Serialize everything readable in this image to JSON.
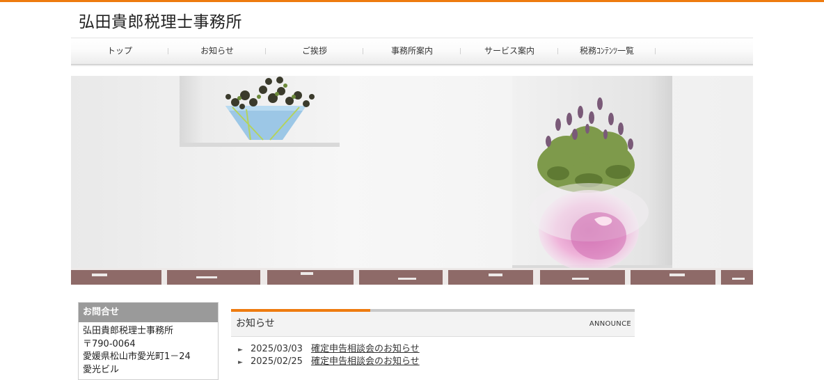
{
  "site": {
    "title": "弘田貴郎税理士事務所"
  },
  "colors": {
    "accent": "#ee7b0f",
    "nav_text": "#333333",
    "sidebar_head": "#9a9a9a"
  },
  "nav": {
    "items": [
      {
        "label": "トップ"
      },
      {
        "label": "お知らせ"
      },
      {
        "label": "ご挨拶"
      },
      {
        "label": "事務所案内"
      },
      {
        "label": "サービス案内"
      },
      {
        "label": "税務ｺﾝﾃﾝﾂ一覧"
      }
    ]
  },
  "sidebar": {
    "heading": "お問合せ",
    "lines": [
      "弘田貴郎税理士事務所",
      "〒790-0064",
      "愛媛県松山市愛光町1－24",
      "愛光ビル"
    ]
  },
  "news": {
    "title": "お知らせ",
    "subtitle": "ANNOUNCE",
    "items": [
      {
        "date": "2025/03/03",
        "text": "確定申告相談会のお知らせ"
      },
      {
        "date": "2025/02/25",
        "text": "確定申告相談会のお知らせ"
      }
    ]
  }
}
